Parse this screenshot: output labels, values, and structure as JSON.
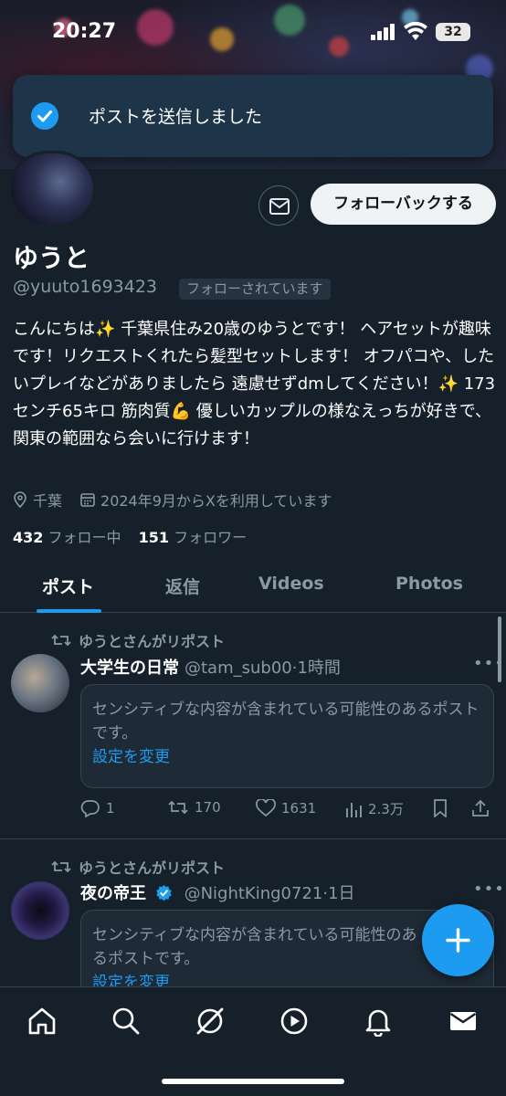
{
  "status_bar": {
    "time": "20:27",
    "battery": "32"
  },
  "toast": {
    "message": "ポストを送信しました"
  },
  "profile": {
    "name": "ゆうと",
    "handle": "@yuuto1693423",
    "follows_you": "フォローされています",
    "follow_back_label": "フォローバックする",
    "bio": "こんにちは✨ 千葉県住み20歳のゆうとです！ ヘアセットが趣味です！リクエストくれたら髪型セットします！ オフパコや、したいプレイなどがありましたら 遠慮せずdmしてください！✨ 173センチ65キロ 筋肉質💪 優しいカップルの様なえっちが好きで、関東の範囲なら会いに行けます！",
    "location": "千葉",
    "joined": "2024年9月からXを利用しています",
    "following_count": "432",
    "following_label": "フォロー中",
    "followers_count": "151",
    "followers_label": "フォロワー"
  },
  "tabs": [
    {
      "label": "ポスト",
      "active": true
    },
    {
      "label": "返信",
      "active": false
    },
    {
      "label": "Videos",
      "active": false
    },
    {
      "label": "Photos",
      "active": false
    }
  ],
  "posts": [
    {
      "repost_label": "ゆうとさんがリポスト",
      "name": "大学生の日常",
      "handle": "@tam_sub00",
      "time": "1時間",
      "sensitive_text": "センシティブな内容が含まれている可能性のあるポストです。",
      "sensitive_link": "設定を変更",
      "replies": "1",
      "reposts": "170",
      "likes": "1631",
      "views": "2.3万"
    },
    {
      "repost_label": "ゆうとさんがリポスト",
      "name": "夜の帝王",
      "handle": "@NightKing0721",
      "time": "1日",
      "sensitive_text": "センシティブな内容が含まれている可能性のあるポストです。",
      "sensitive_link": "設定を変更"
    }
  ],
  "colors": {
    "accent": "#1d9bf0",
    "background": "#15202b",
    "muted": "#8b98a5"
  },
  "icons": {
    "nav": [
      "home-icon",
      "search-icon",
      "grok-icon",
      "play-icon",
      "bell-icon",
      "mail-icon"
    ]
  }
}
